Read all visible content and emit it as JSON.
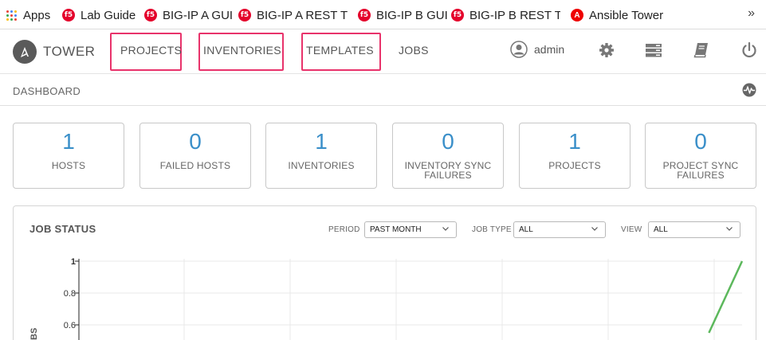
{
  "bookmarks": {
    "items": [
      {
        "label": "Apps",
        "icon": "apps-grid-icon"
      },
      {
        "label": "Lab Guide",
        "icon": "f5-icon"
      },
      {
        "label": "BIG-IP A GUI",
        "icon": "f5-icon"
      },
      {
        "label": "BIG-IP A REST TO",
        "icon": "f5-icon"
      },
      {
        "label": "BIG-IP B GUI",
        "icon": "f5-icon"
      },
      {
        "label": "BIG-IP B REST TO",
        "icon": "f5-icon"
      },
      {
        "label": "Ansible Tower",
        "icon": "ansible-icon"
      }
    ],
    "more": "»",
    "f5_glyph": "f5",
    "ansible_glyph": "A"
  },
  "topnav": {
    "brand": "TOWER",
    "items": [
      "PROJECTS",
      "INVENTORIES",
      "TEMPLATES",
      "JOBS"
    ],
    "highlighted": [
      "PROJECTS",
      "INVENTORIES",
      "TEMPLATES"
    ],
    "highlight_color": "#e8336b",
    "user": "admin",
    "icons": [
      "user-avatar-icon",
      "gear-icon",
      "server-icon",
      "book-icon",
      "power-icon"
    ]
  },
  "breadcrumb": "DASHBOARD",
  "counts": [
    {
      "value": "1",
      "label": "HOSTS"
    },
    {
      "value": "0",
      "label": "FAILED HOSTS"
    },
    {
      "value": "1",
      "label": "INVENTORIES"
    },
    {
      "value": "0",
      "label": "INVENTORY SYNC FAILURES"
    },
    {
      "value": "1",
      "label": "PROJECTS"
    },
    {
      "value": "0",
      "label": "PROJECT SYNC FAILURES"
    }
  ],
  "accent_color": "#3a8fc9",
  "job_status": {
    "title": "JOB STATUS",
    "filters": {
      "period_label": "PERIOD",
      "period_value": "PAST MONTH",
      "job_type_label": "JOB TYPE",
      "job_type_value": "ALL",
      "view_label": "VIEW",
      "view_value": "ALL"
    }
  },
  "chart_data": {
    "type": "line",
    "y_ticks": [
      "1",
      "0.8",
      "0.6"
    ],
    "ylabel_visible": "BS",
    "grid": true,
    "series": [
      {
        "color": "#5cb85c",
        "points": [
          [
            0.95,
            0.55
          ],
          [
            1.0,
            1.0
          ]
        ]
      }
    ]
  }
}
